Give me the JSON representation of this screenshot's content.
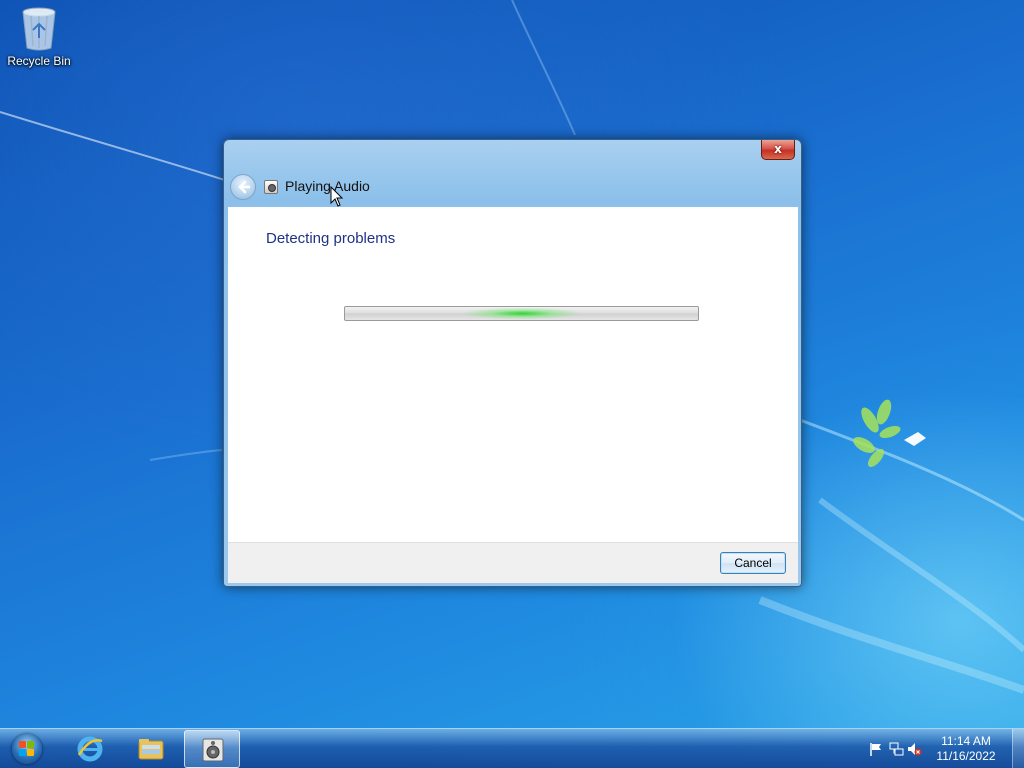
{
  "desktop": {
    "icons": [
      {
        "label": "Recycle Bin",
        "icon": "recycle-bin-icon"
      }
    ]
  },
  "window": {
    "title": "Playing Audio",
    "close_label": "x",
    "heading": "Detecting problems",
    "progress": {
      "state": "indeterminate",
      "position": 0.5
    },
    "cancel_label": "Cancel"
  },
  "taskbar": {
    "pinned": [
      {
        "name": "start-button",
        "icon": "windows-logo-icon"
      },
      {
        "name": "internet-explorer",
        "icon": "internet-explorer-icon"
      },
      {
        "name": "windows-explorer",
        "icon": "folder-icon"
      },
      {
        "name": "troubleshooter",
        "icon": "speaker-icon",
        "active": true
      }
    ],
    "tray": {
      "icons": [
        "action-center-flag-icon",
        "network-icon",
        "volume-muted-icon"
      ],
      "time": "11:14 AM",
      "date": "11/16/2022"
    }
  },
  "colors": {
    "heading": "#1e3287",
    "progress_glow": "#2ed62e",
    "close_button": "#c23222"
  }
}
